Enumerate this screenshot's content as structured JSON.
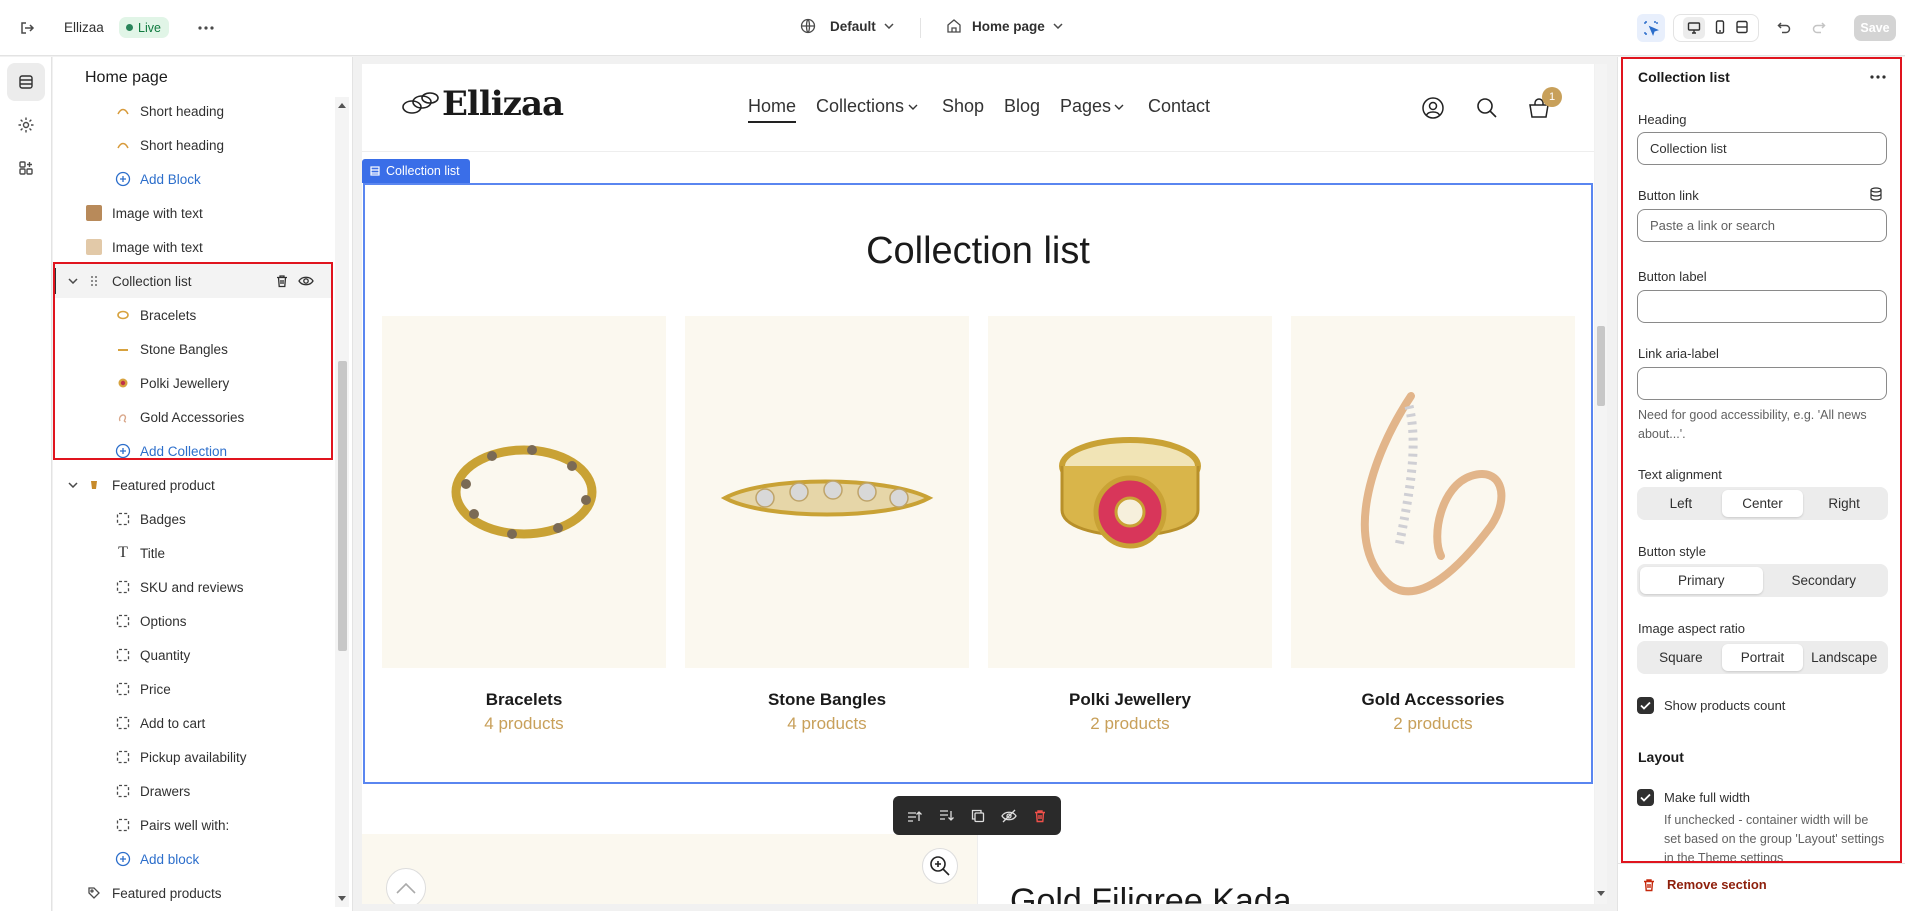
{
  "topbar": {
    "store_name": "Ellizaa",
    "status_badge": "Live",
    "theme_label": "Default",
    "page_label": "Home page",
    "save_label": "Save"
  },
  "sidebar": {
    "title": "Home page",
    "items": [
      {
        "label": "Short heading"
      },
      {
        "label": "Short heading"
      },
      {
        "label": "Add Block"
      },
      {
        "label": "Image with text"
      },
      {
        "label": "Image with text"
      },
      {
        "label": "Collection list"
      },
      {
        "label": "Bracelets"
      },
      {
        "label": "Stone Bangles"
      },
      {
        "label": "Polki Jewellery"
      },
      {
        "label": "Gold Accessories"
      },
      {
        "label": "Add Collection"
      },
      {
        "label": "Featured product"
      },
      {
        "label": "Badges"
      },
      {
        "label": "Title"
      },
      {
        "label": "SKU and reviews"
      },
      {
        "label": "Options"
      },
      {
        "label": "Quantity"
      },
      {
        "label": "Price"
      },
      {
        "label": "Add to cart"
      },
      {
        "label": "Pickup availability"
      },
      {
        "label": "Drawers"
      },
      {
        "label": "Pairs well with:"
      },
      {
        "label": "Add block"
      },
      {
        "label": "Featured products"
      }
    ]
  },
  "preview": {
    "logo": "Ellizaa",
    "nav": [
      "Home",
      "Collections",
      "Shop",
      "Blog",
      "Pages",
      "Contact"
    ],
    "cart_count": "1",
    "section_tag": "Collection list",
    "heading": "Collection list",
    "cards": [
      {
        "title": "Bracelets",
        "count": "4 products"
      },
      {
        "title": "Stone Bangles",
        "count": "4 products"
      },
      {
        "title": "Polki Jewellery",
        "count": "2 products"
      },
      {
        "title": "Gold Accessories",
        "count": "2 products"
      }
    ],
    "next_heading": "Gold Filigree Kada"
  },
  "panel": {
    "title": "Collection list",
    "heading_label": "Heading",
    "heading_value": "Collection list",
    "button_link_label": "Button link",
    "button_link_placeholder": "Paste a link or search",
    "button_label_label": "Button label",
    "button_label_value": "",
    "aria_label": "Link aria-label",
    "aria_value": "",
    "aria_help": "Need for good accessibility, e.g. 'All news about...'.",
    "text_alignment_label": "Text alignment",
    "text_alignment_options": [
      "Left",
      "Center",
      "Right"
    ],
    "text_alignment_selected": "Center",
    "button_style_label": "Button style",
    "button_style_options": [
      "Primary",
      "Secondary"
    ],
    "button_style_selected": "Primary",
    "aspect_label": "Image aspect ratio",
    "aspect_options": [
      "Square",
      "Portrait",
      "Landscape"
    ],
    "aspect_selected": "Portrait",
    "show_count_label": "Show products count",
    "show_count_checked": true,
    "layout_heading": "Layout",
    "full_width_label": "Make full width",
    "full_width_checked": true,
    "full_width_help": "If unchecked - container width will be set based on the group 'Layout' settings in the Theme settings",
    "remove_label": "Remove section"
  },
  "colors": {
    "accent_blue": "#3a6ee8",
    "highlight_red": "#e0141e",
    "gold_text": "#c8a05a",
    "live_green": "#0f7b3f",
    "delete_red": "#c5280c"
  }
}
